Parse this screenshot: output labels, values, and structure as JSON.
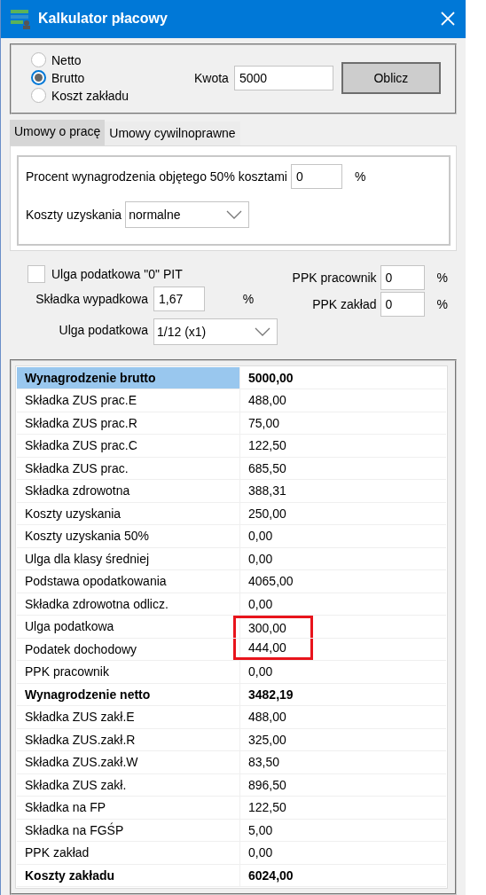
{
  "window": {
    "title": "Kalkulator płacowy"
  },
  "mode": {
    "options": [
      {
        "label": "Netto",
        "selected": false
      },
      {
        "label": "Brutto",
        "selected": true
      },
      {
        "label": "Koszt zakładu",
        "selected": false
      }
    ]
  },
  "amount": {
    "label": "Kwota",
    "value": "5000"
  },
  "calculate_button": "Oblicz",
  "tabs": [
    {
      "label": "Umowy o pracę",
      "selected": true
    },
    {
      "label": "Umowy cywilnoprawne",
      "selected": false
    }
  ],
  "tab_panel": {
    "percent": {
      "label": "Procent wynagrodzenia objętego 50% kosztami",
      "value": "0",
      "unit": "%"
    },
    "costs": {
      "label": "Koszty uzyskania",
      "value": "normalne"
    }
  },
  "options": {
    "zero_pit": {
      "label": "Ulga podatkowa \"0\" PIT",
      "checked": false
    },
    "accident": {
      "label": "Składka wypadkowa",
      "value": "1,67",
      "unit": "%"
    },
    "relief": {
      "label": "Ulga podatkowa",
      "value": "1/12 (x1)"
    },
    "ppk_employee": {
      "label": "PPK pracownik",
      "value": "0",
      "unit": "%"
    },
    "ppk_employer": {
      "label": "PPK zakład",
      "value": "0",
      "unit": "%"
    }
  },
  "results": {
    "rows": [
      {
        "label": "Wynagrodzenie brutto",
        "value": "5000,00",
        "bold": true,
        "selected": true,
        "marked": false
      },
      {
        "label": "Składka ZUS prac.E",
        "value": "488,00",
        "bold": false,
        "selected": false,
        "marked": false
      },
      {
        "label": "Składka ZUS prac.R",
        "value": "75,00",
        "bold": false,
        "selected": false,
        "marked": false
      },
      {
        "label": "Składka ZUS prac.C",
        "value": "122,50",
        "bold": false,
        "selected": false,
        "marked": false
      },
      {
        "label": "Składka ZUS prac.",
        "value": "685,50",
        "bold": false,
        "selected": false,
        "marked": false
      },
      {
        "label": "Składka zdrowotna",
        "value": "388,31",
        "bold": false,
        "selected": false,
        "marked": false
      },
      {
        "label": "Koszty uzyskania",
        "value": "250,00",
        "bold": false,
        "selected": false,
        "marked": false
      },
      {
        "label": "Koszty uzyskania 50%",
        "value": "0,00",
        "bold": false,
        "selected": false,
        "marked": false
      },
      {
        "label": "Ulga dla klasy średniej",
        "value": "0,00",
        "bold": false,
        "selected": false,
        "marked": false
      },
      {
        "label": "Podstawa opodatkowania",
        "value": "4065,00",
        "bold": false,
        "selected": false,
        "marked": false
      },
      {
        "label": "Składka zdrowotna odlicz.",
        "value": "0,00",
        "bold": false,
        "selected": false,
        "marked": false
      },
      {
        "label": "Ulga podatkowa",
        "value": "300,00",
        "bold": false,
        "selected": false,
        "marked": true
      },
      {
        "label": "Podatek dochodowy",
        "value": "444,00",
        "bold": false,
        "selected": false,
        "marked": true
      },
      {
        "label": "PPK pracownik",
        "value": "0,00",
        "bold": false,
        "selected": false,
        "marked": false
      },
      {
        "label": "Wynagrodzenie netto",
        "value": "3482,19",
        "bold": true,
        "selected": false,
        "marked": false
      },
      {
        "label": "Składka ZUS zakł.E",
        "value": "488,00",
        "bold": false,
        "selected": false,
        "marked": false
      },
      {
        "label": "Składka ZUS.zakł.R",
        "value": "325,00",
        "bold": false,
        "selected": false,
        "marked": false
      },
      {
        "label": "Składka ZUS.zakł.W",
        "value": "83,50",
        "bold": false,
        "selected": false,
        "marked": false
      },
      {
        "label": "Składka ZUS zakł.",
        "value": "896,50",
        "bold": false,
        "selected": false,
        "marked": false
      },
      {
        "label": "Składka na FP",
        "value": "122,50",
        "bold": false,
        "selected": false,
        "marked": false
      },
      {
        "label": "Składka na FGŚP",
        "value": "5,00",
        "bold": false,
        "selected": false,
        "marked": false
      },
      {
        "label": "PPK zakład",
        "value": "0,00",
        "bold": false,
        "selected": false,
        "marked": false
      },
      {
        "label": "Koszty zakładu",
        "value": "6024,00",
        "bold": true,
        "selected": false,
        "marked": false
      }
    ]
  }
}
